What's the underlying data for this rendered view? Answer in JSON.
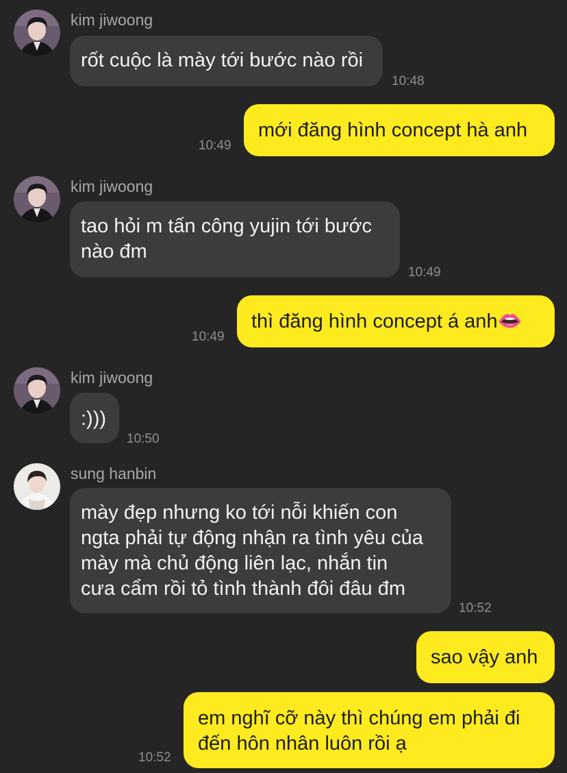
{
  "messages": [
    {
      "sender": "kim jiwoong",
      "text": "rốt cuộc là mày tới bước nào rồi",
      "time": "10:48"
    },
    {
      "text": "mới đăng hình concept hà anh",
      "time": "10:49"
    },
    {
      "sender": "kim jiwoong",
      "text": "tao hỏi m tấn công yujin tới bước\nnào đm",
      "time": "10:49"
    },
    {
      "text": "thì đăng hình concept á anh👄",
      "time": "10:49"
    },
    {
      "sender": "kim jiwoong",
      "text": ":)))",
      "time": "10:50"
    },
    {
      "sender": "sung hanbin",
      "text": "mày đẹp nhưng ko tới nỗi khiến con\nngta phải tự động nhận ra tình yêu của\nmày mà chủ động liên lạc, nhắn tin\ncưa cẩm rồi tỏ tình thành đôi đâu đm",
      "time": "10:52"
    },
    {
      "text": "sao vậy anh"
    },
    {
      "text": "em nghĩ cỡ này thì chúng em phải đi\nđến hôn nhân luôn rồi ạ",
      "time": "10:52"
    }
  ],
  "colors": {
    "background": "#252525",
    "incoming_bubble": "#3c3c3c",
    "outgoing_bubble": "#fdea1f"
  },
  "avatars": [
    "profile-photo-kim-jiwoong",
    "profile-photo-kim-jiwoong",
    "profile-photo-kim-jiwoong",
    "profile-photo-sung-hanbin"
  ]
}
